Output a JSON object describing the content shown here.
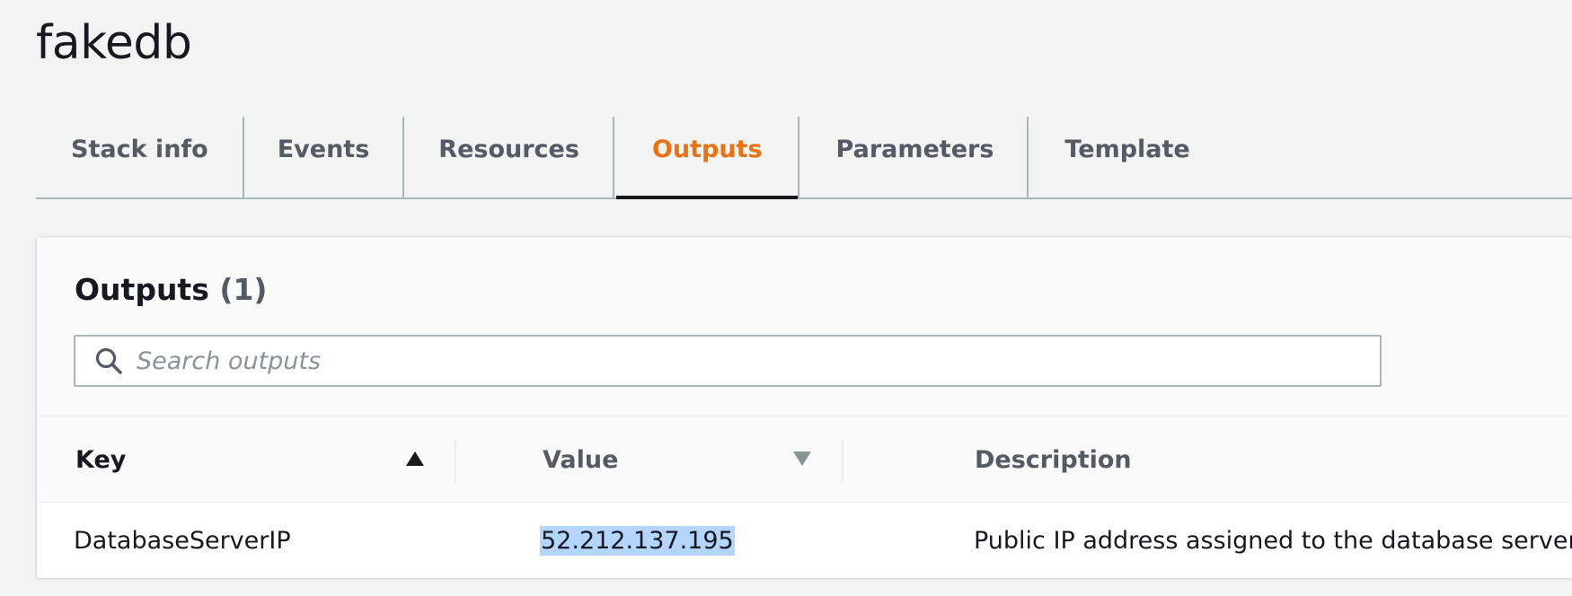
{
  "stack": {
    "name": "fakedb"
  },
  "tabs": [
    {
      "label": "Stack info",
      "active": false
    },
    {
      "label": "Events",
      "active": false
    },
    {
      "label": "Resources",
      "active": false
    },
    {
      "label": "Outputs",
      "active": true
    },
    {
      "label": "Parameters",
      "active": false
    },
    {
      "label": "Template",
      "active": false
    }
  ],
  "panel": {
    "title": "Outputs",
    "count": "(1)",
    "search": {
      "placeholder": "Search outputs",
      "value": "",
      "icon": "search-icon"
    }
  },
  "table": {
    "columns": [
      {
        "label": "Key",
        "sort": "ascending",
        "icon": "sort-ascending-icon"
      },
      {
        "label": "Value",
        "sort": "none",
        "icon": "sort-descending-icon"
      },
      {
        "label": "Description"
      }
    ],
    "rows": [
      {
        "key": "DatabaseServerIP",
        "value": "52.212.137.195",
        "description": "Public IP address assigned to the database server",
        "value_selected": true
      }
    ]
  },
  "colors": {
    "active_tab": "#ec7211",
    "text": "#16191f",
    "muted_text": "#545b64",
    "selection": "#b4d5fe",
    "background": "#f2f3f3"
  }
}
